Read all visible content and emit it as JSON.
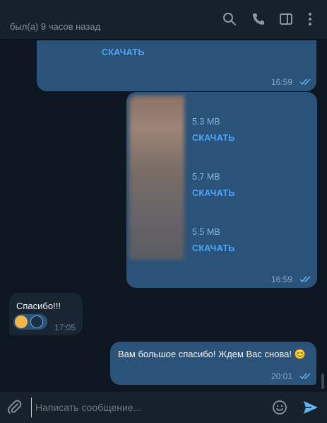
{
  "header": {
    "status": "был(а) 9 часов назад",
    "icons": [
      "search-icon",
      "phone-icon",
      "sidebar-icon",
      "more-icon"
    ]
  },
  "messages": {
    "first": {
      "download_label": "СКАЧАТЬ",
      "time": "16:59"
    },
    "files": {
      "items": [
        {
          "size": "5.3 MB",
          "download_label": "СКАЧАТЬ"
        },
        {
          "size": "5.7 MB",
          "download_label": "СКАЧАТЬ"
        },
        {
          "size": "5.5 MB",
          "download_label": "СКАЧАТЬ"
        }
      ],
      "time": "16:59"
    },
    "incoming": {
      "text": "Спасибо!!!",
      "time": "17:05",
      "reactions": [
        "🥰",
        "🐳"
      ]
    },
    "last": {
      "text": "Вам большое спасибо! Ждем Вас снова! 😊",
      "time": "20:01"
    }
  },
  "composer": {
    "placeholder": "Написать сообщение...",
    "icons": [
      "attach-icon",
      "emoji-icon",
      "send-icon"
    ]
  },
  "colors": {
    "background": "#0e1621",
    "bubble_out": "#2b5278",
    "bubble_in": "#182533",
    "accent": "#4ea4f6"
  }
}
